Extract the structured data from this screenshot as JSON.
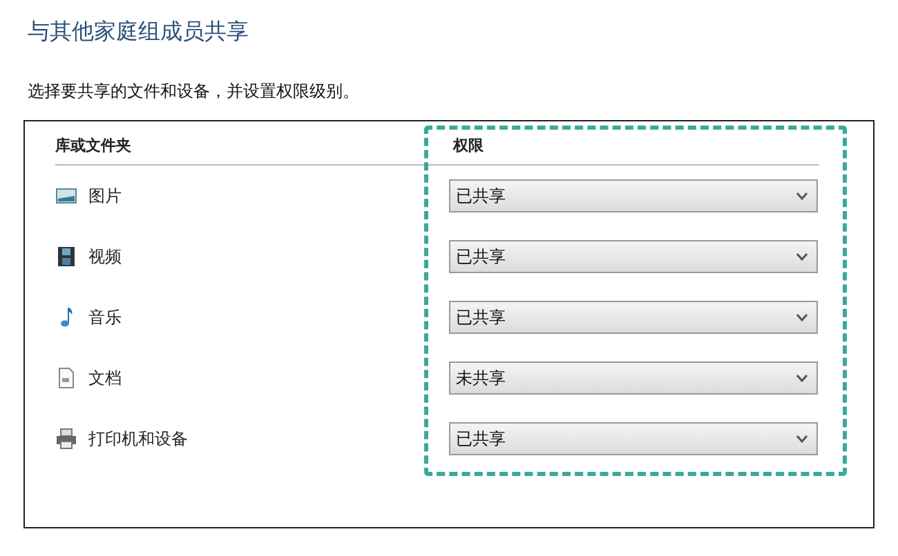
{
  "title": "与其他家庭组成员共享",
  "description": "选择要共享的文件和设备，并设置权限级别。",
  "table": {
    "columns": [
      "库或文件夹",
      "权限"
    ],
    "rows": [
      {
        "kind": "pictures",
        "name": "图片",
        "permission": "已共享"
      },
      {
        "kind": "videos",
        "name": "视频",
        "permission": "已共享"
      },
      {
        "kind": "music",
        "name": "音乐",
        "permission": "已共享"
      },
      {
        "kind": "documents",
        "name": "文档",
        "permission": "未共享"
      },
      {
        "kind": "printers",
        "name": "打印机和设备",
        "permission": "已共享"
      }
    ]
  }
}
